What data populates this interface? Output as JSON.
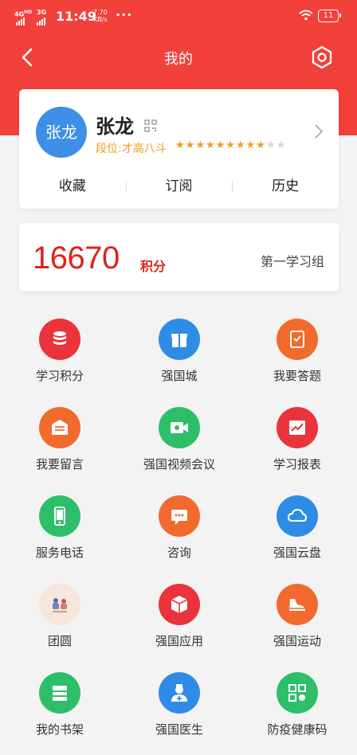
{
  "status": {
    "network1": "4G",
    "network1_sup": "HD",
    "network2": "3G",
    "time": "11:49",
    "speed_value": "7.70",
    "speed_unit": "KB/s",
    "more": "···",
    "battery": "11"
  },
  "nav": {
    "title": "我的"
  },
  "profile": {
    "avatar_text": "张龙",
    "name": "张龙",
    "rank": "段位:才高八斗",
    "stars_total": 11,
    "stars_filled": 9,
    "tabs": [
      "收藏",
      "订阅",
      "历史"
    ]
  },
  "score": {
    "points": "16670",
    "unit": "积分",
    "group": "第一学习组"
  },
  "grid": {
    "items": [
      {
        "label": "学习积分",
        "icon": "coins-icon",
        "color": "#e8343a"
      },
      {
        "label": "强国城",
        "icon": "gift-box-icon",
        "color": "#2f8ce6"
      },
      {
        "label": "我要答题",
        "icon": "clipboard-check-icon",
        "color": "#f26a2d"
      },
      {
        "label": "我要留言",
        "icon": "mailbox-icon",
        "color": "#f26a2d"
      },
      {
        "label": "强国视频会议",
        "icon": "video-camera-icon",
        "color": "#2ebe6a"
      },
      {
        "label": "学习报表",
        "icon": "chart-report-icon",
        "color": "#e8343a"
      },
      {
        "label": "服务电话",
        "icon": "phone-icon",
        "color": "#2ebe6a"
      },
      {
        "label": "咨询",
        "icon": "chat-bubble-icon",
        "color": "#f26a2d"
      },
      {
        "label": "强国云盘",
        "icon": "cloud-icon",
        "color": "#2f8ce6"
      },
      {
        "label": "团圆",
        "icon": "family-reunion-icon",
        "color": "#f7e6dc"
      },
      {
        "label": "强国应用",
        "icon": "cube-icon",
        "color": "#e8343a"
      },
      {
        "label": "强国运动",
        "icon": "sneaker-icon",
        "color": "#f26a2d"
      },
      {
        "label": "我的书架",
        "icon": "book-shelf-icon",
        "color": "#2ebe6a"
      },
      {
        "label": "强国医生",
        "icon": "doctor-icon",
        "color": "#2f8ce6"
      },
      {
        "label": "防疫健康码",
        "icon": "qr-health-code-icon",
        "color": "#2ebe6a"
      }
    ]
  },
  "colors": {
    "header_red": "#f2403a",
    "accent_red": "#e0221a",
    "rank_orange": "#f29a1f",
    "avatar_blue": "#3d8fe8"
  }
}
